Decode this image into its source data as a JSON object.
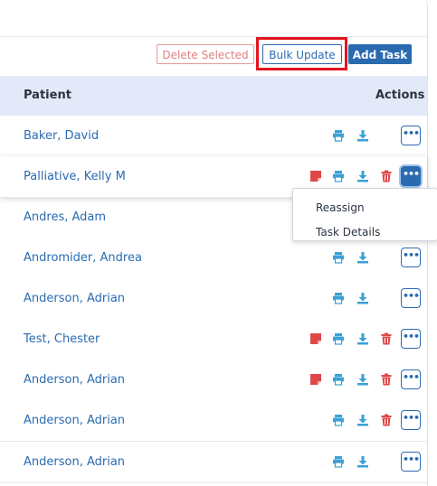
{
  "toolbar": {
    "delete_selected": "Delete Selected",
    "bulk_update": "Bulk Update",
    "add_task": "Add Task"
  },
  "table": {
    "headers": {
      "patient": "Patient",
      "actions": "Actions"
    },
    "rows": [
      {
        "patient": "Baker, David"
      },
      {
        "patient": "Palliative, Kelly M"
      },
      {
        "patient": "Andres, Adam"
      },
      {
        "patient": "Andromider, Andrea"
      },
      {
        "patient": "Anderson, Adrian"
      },
      {
        "patient": "Test, Chester"
      },
      {
        "patient": "Anderson, Adrian"
      },
      {
        "patient": "Anderson, Adrian"
      },
      {
        "patient": "Anderson, Adrian"
      }
    ]
  },
  "menu": {
    "items": [
      "Reassign",
      "Task Details"
    ]
  },
  "colors": {
    "accent": "#2a6bb0",
    "header_bg": "#e4e9fa",
    "danger": "#e04848",
    "highlight": "#e3141e",
    "icon_teal": "#3aa0d6"
  },
  "icons": [
    "note-icon",
    "print-icon",
    "download-icon",
    "trash-icon",
    "more-icon"
  ]
}
